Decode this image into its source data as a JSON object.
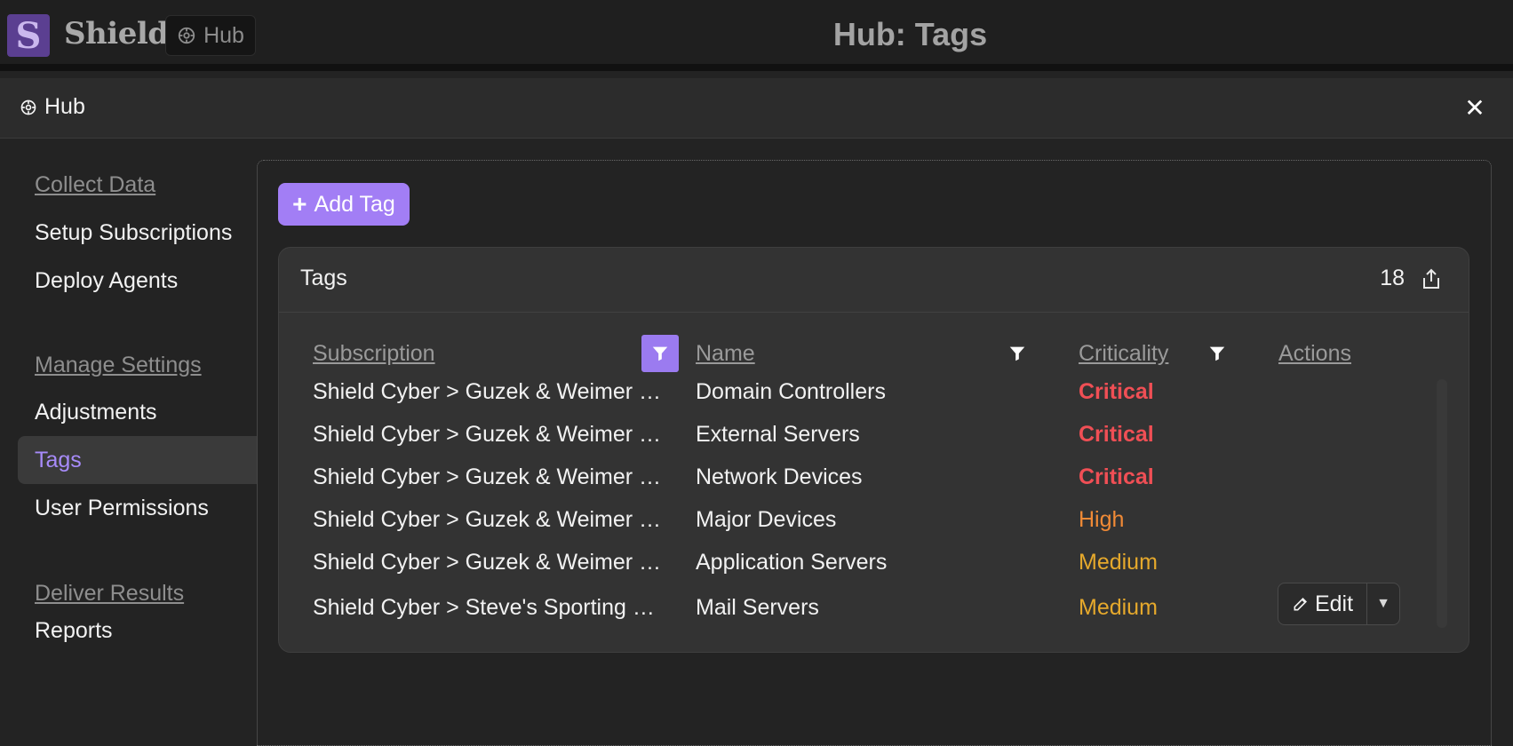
{
  "topbar": {
    "logo_letter": "S",
    "brand": "Shield",
    "hub_pill_label": "Hub",
    "page_title": "Hub: Tags"
  },
  "modal": {
    "title": "Hub",
    "close_glyph": "✕"
  },
  "sidebar": {
    "sections": [
      {
        "label": "Collect Data",
        "items": [
          "Setup Subscriptions",
          "Deploy Agents"
        ]
      },
      {
        "label": "Manage Settings",
        "items": [
          "Adjustments",
          "Tags",
          "User Permissions"
        ]
      },
      {
        "label": "Deliver Results",
        "items": [
          "Reports"
        ]
      }
    ],
    "active_item": "Tags"
  },
  "toolbar": {
    "add_tag_label": "Add Tag"
  },
  "tags_card": {
    "title": "Tags",
    "count": "18",
    "columns": [
      "Subscription",
      "Name",
      "Criticality",
      "Actions"
    ],
    "rows": [
      {
        "subscription": "Shield Cyber > Guzek & Weimer LLP",
        "name": "Domain Controllers",
        "criticality": "Critical"
      },
      {
        "subscription": "Shield Cyber > Guzek & Weimer LLP",
        "name": "External Servers",
        "criticality": "Critical"
      },
      {
        "subscription": "Shield Cyber > Guzek & Weimer LLP",
        "name": "Network Devices",
        "criticality": "Critical"
      },
      {
        "subscription": "Shield Cyber > Guzek & Weimer LLP",
        "name": "Major Devices",
        "criticality": "High"
      },
      {
        "subscription": "Shield Cyber > Guzek & Weimer LLP",
        "name": "Application Servers",
        "criticality": "Medium"
      },
      {
        "subscription": "Shield Cyber > Steve's Sporting G...",
        "name": "Mail Servers",
        "criticality": "Medium"
      }
    ],
    "edit_label": "Edit"
  },
  "colors": {
    "accent": "#a27ef5",
    "critical": "#f04f55",
    "high": "#f08a36",
    "medium": "#e6a92c"
  },
  "icons": [
    "hub-gear-icon",
    "close-icon",
    "plus-icon",
    "export-icon",
    "filter-icon",
    "pencil-icon",
    "caret-down-icon"
  ]
}
